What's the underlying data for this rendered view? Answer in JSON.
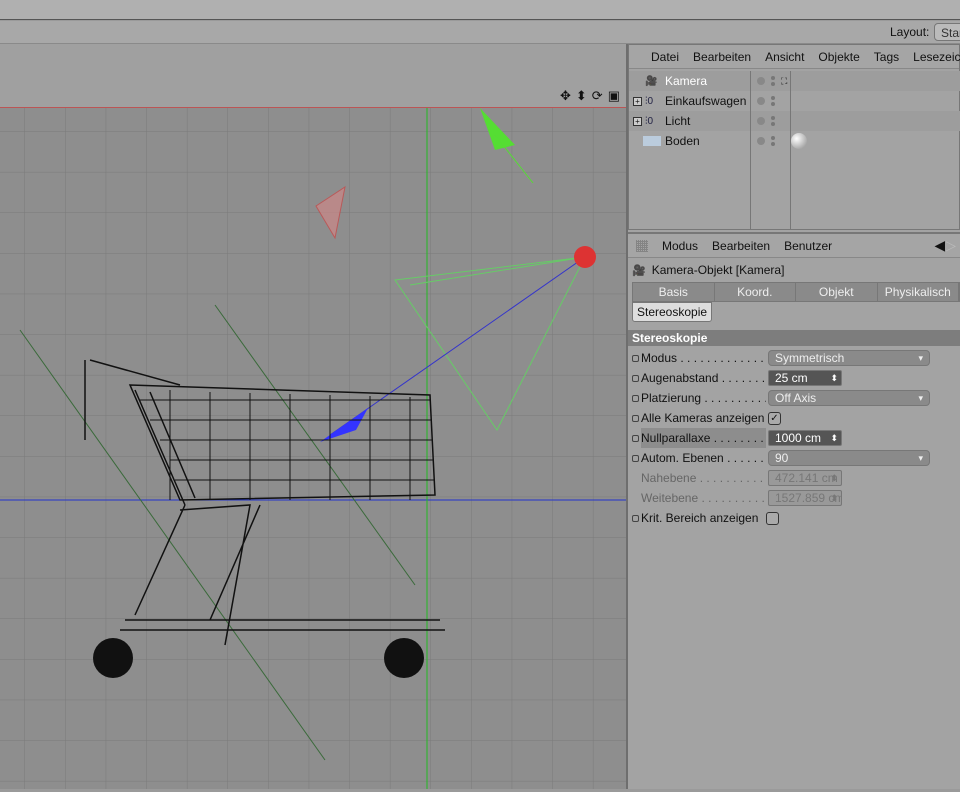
{
  "layout": {
    "label": "Layout:",
    "value": "Start"
  },
  "viewport": {
    "icons": [
      "move-icon",
      "zoom-icon",
      "rotate-icon",
      "maximize-icon"
    ]
  },
  "object_manager": {
    "menu": [
      "Datei",
      "Bearbeiten",
      "Ansicht",
      "Objekte",
      "Tags",
      "Lesezeichen"
    ],
    "objects": [
      {
        "name": "Kamera",
        "icon": "camera-icon",
        "expandable": false
      },
      {
        "name": "Einkaufswagen",
        "icon": "null-object-icon",
        "expandable": true
      },
      {
        "name": "Licht",
        "icon": "null-object-icon",
        "expandable": true
      },
      {
        "name": "Boden",
        "icon": "floor-icon",
        "expandable": false
      }
    ]
  },
  "attribute_manager": {
    "menu": [
      "Modus",
      "Bearbeiten",
      "Benutzer"
    ],
    "title": "Kamera-Objekt [Kamera]",
    "tabs": [
      "Basis",
      "Koord.",
      "Objekt",
      "Physikalisch"
    ],
    "active_tab": "Stereoskopie",
    "section": "Stereoskopie",
    "params": {
      "modus": {
        "label": "Modus",
        "value": "Symmetrisch"
      },
      "augen": {
        "label": "Augenabstand",
        "value": "25 cm"
      },
      "platz": {
        "label": "Platzierung",
        "value": "Off Axis"
      },
      "alle": {
        "label": "Alle Kameras anzeigen",
        "checked": true
      },
      "null": {
        "label": "Nullparallaxe",
        "value": "1000 cm"
      },
      "autom": {
        "label": "Autom. Ebenen",
        "value": "90"
      },
      "nah": {
        "label": "Nahebene",
        "value": "472.141 cm"
      },
      "weit": {
        "label": "Weitebene",
        "value": "1527.859 cm"
      },
      "krit": {
        "label": "Krit. Bereich anzeigen",
        "checked": false
      }
    }
  }
}
